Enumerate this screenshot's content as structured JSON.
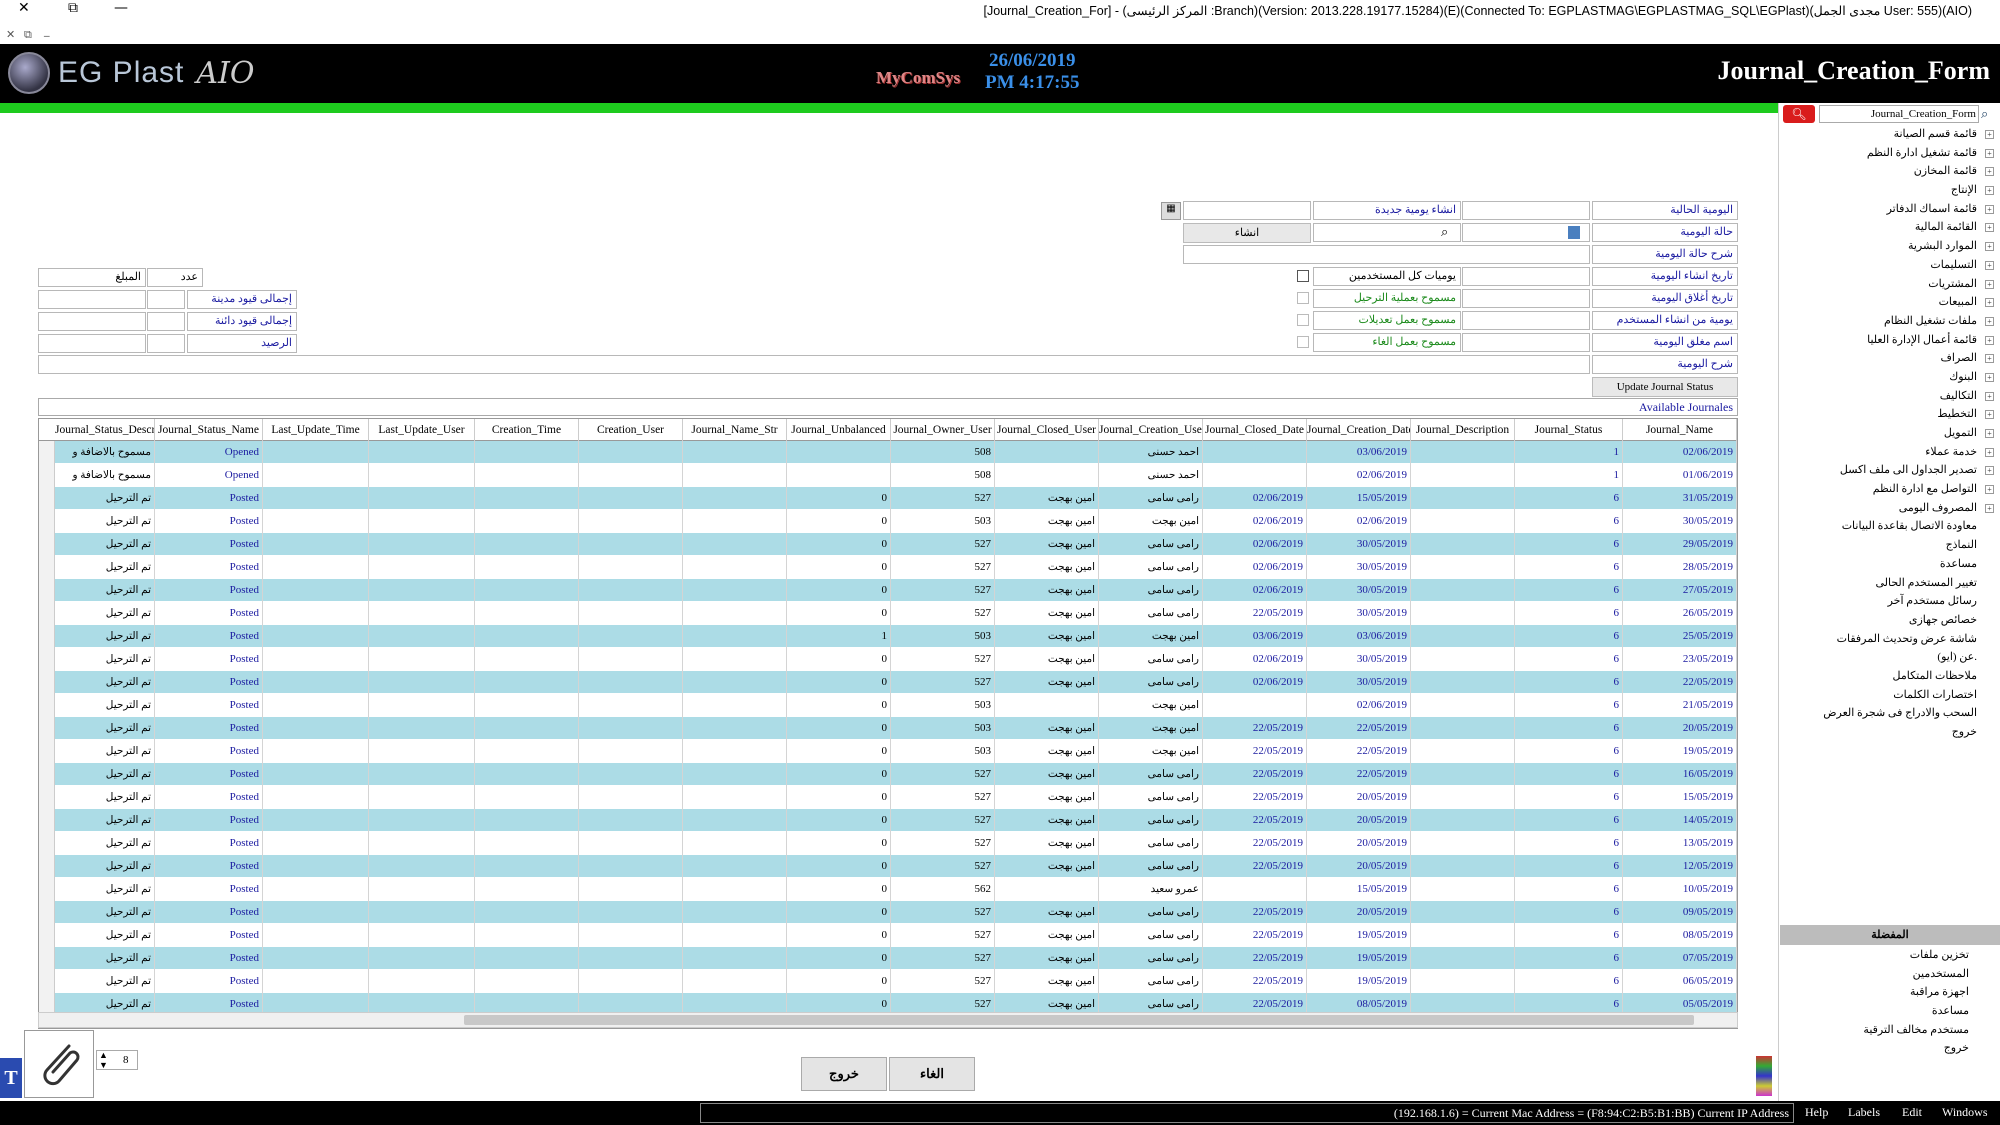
{
  "window": {
    "title": "[Journal_Creation_For] - (المركز الرئيسى :Branch)(Version: 2013.228.19177.15284)(E)(Connected To: EGPLASTMAG\\EGPLASTMAG_SQL\\EGPlast)(مجدى الجمل User: 555)(AIO)",
    "close": "✕",
    "restore": "⧉",
    "minimize": "—",
    "sub_close": "✕",
    "sub_restore": "⧉",
    "sub_min": "_"
  },
  "header": {
    "app_name": "EG Plast",
    "app_suffix": "AIO",
    "vendor": "MyComSys",
    "date": "26/06/2019",
    "time": "PM 4:17:55",
    "form_title": "Journal_Creation_Form"
  },
  "sidebar": {
    "search_value": "Journal_Creation_Form",
    "items": [
      {
        "label": "قائمة قسم الصيانة",
        "exp": "+"
      },
      {
        "label": "قائمة تشغيل ادارة النظم",
        "exp": "+"
      },
      {
        "label": "قائمة المخازن",
        "exp": "+"
      },
      {
        "label": "الإنتاج",
        "exp": "+"
      },
      {
        "label": "قائمة اسماك الدفاتر",
        "exp": "+"
      },
      {
        "label": "القائمة المالية",
        "exp": "+"
      },
      {
        "label": "الموارد البشرية",
        "exp": "+"
      },
      {
        "label": "التسليمات",
        "exp": "+"
      },
      {
        "label": "المشتريات",
        "exp": "+"
      },
      {
        "label": "المبيعات",
        "exp": "+"
      },
      {
        "label": "ملفات تشغيل النظام",
        "exp": "+"
      },
      {
        "label": "قائمة أعمال الإدارة العليا",
        "exp": "+"
      },
      {
        "label": "الصراف",
        "exp": "+"
      },
      {
        "label": "البنوك",
        "exp": "+"
      },
      {
        "label": "التكاليف",
        "exp": "+"
      },
      {
        "label": "التخطيط",
        "exp": "+"
      },
      {
        "label": "التمويل",
        "exp": "+"
      },
      {
        "label": "خدمة عملاء",
        "exp": "+"
      },
      {
        "label": "تصدير الجداول الى ملف اكسل",
        "exp": "+"
      },
      {
        "label": "التواصل مع ادارة النظم",
        "exp": "+"
      },
      {
        "label": "المصروف اليومى",
        "exp": "+"
      },
      {
        "label": "معاودة الاتصال بقاعدة البيانات",
        "exp": ""
      },
      {
        "label": "النماذج",
        "exp": ""
      },
      {
        "label": "مساعدة",
        "exp": ""
      },
      {
        "label": "تغيير المستخدم الحالى",
        "exp": ""
      },
      {
        "label": "رسائل مستخدم آخر",
        "exp": ""
      },
      {
        "label": "خصائص جهازى",
        "exp": ""
      },
      {
        "label": "شاشة عرض وتحديث المرفقات",
        "exp": ""
      },
      {
        "label": "عن (ايو).",
        "exp": ""
      },
      {
        "label": "ملاحظات المتكامل",
        "exp": ""
      },
      {
        "label": "اختصارات الكلمات",
        "exp": ""
      },
      {
        "label": "السحب والادراج فى شجرة العرض",
        "exp": ""
      },
      {
        "label": "خروج",
        "exp": ""
      }
    ],
    "section_title": "المفضلة",
    "bottom_items": [
      "تخزين ملفات",
      "المستخدمين",
      "اجهزة مراقبة",
      "مساعدة",
      "مستخدم مخالف الترقية",
      "خروج"
    ]
  },
  "form": {
    "current_journal_label": "اليومية الحالية",
    "new_journal_label": "انشاء يومية جديدة",
    "journal_status_label": "حالة اليومية",
    "create_button": "انشاء",
    "status_desc_label": "شرح حالة اليومية",
    "creation_date_label": "تاريخ انشاء اليومية",
    "all_users_label": "يوميات كل المستخدمين",
    "closing_date_label": "تاريخ أغلاق اليومية",
    "allow_carry_label": "مسموح بعملية الترحيل",
    "created_by_label": "يومية من انشاء المستخدم",
    "allow_edit_label": "مسموح بعمل تعديلات",
    "closed_by_label": "اسم مغلق اليومية",
    "allow_cancel_label": "مسموح بعمل الغاء",
    "journal_desc_label": "شرح اليومية",
    "update_button": "Update Journal Status",
    "amount_label": "المبلغ",
    "count_label": "عدد",
    "total_debit_label": "إجمالى قيود مدينة",
    "total_credit_label": "إجمالى قيود دائنة",
    "balance_label": "الرصيد",
    "available_label": "Available Journales"
  },
  "grid": {
    "headers": [
      "Journal_Status_Descript",
      "Journal_Status_Name",
      "Last_Update_Time",
      "Last_Update_User",
      "Creation_Time",
      "Creation_User",
      "Journal_Name_Str",
      "Journal_Unbalanced",
      "Journal_Owner_User",
      "Journal_Closed_User",
      "Journal_Creation_User",
      "Journal_Closed_Date",
      "Journal_Creation_Date",
      "Journal_Description",
      "Journal_Status",
      "Journal_Name"
    ],
    "rows": [
      {
        "desc": "مسموح بالاضافة و",
        "sname": "Opened",
        "unb": "",
        "owner": "508",
        "closed_user": "",
        "cr_user": "احمد حسنى",
        "closed_date": "",
        "cr_date": "03/06/2019",
        "status": "1",
        "name": "02/06/2019"
      },
      {
        "desc": "مسموح بالاضافة و",
        "sname": "Opened",
        "unb": "",
        "owner": "508",
        "closed_user": "",
        "cr_user": "احمد حسنى",
        "closed_date": "",
        "cr_date": "02/06/2019",
        "status": "1",
        "name": "01/06/2019"
      },
      {
        "desc": "تم الترحيل",
        "sname": "Posted",
        "unb": "0",
        "owner": "527",
        "closed_user": "امين بهجت",
        "cr_user": "رامى سامى",
        "closed_date": "02/06/2019",
        "cr_date": "15/05/2019",
        "status": "6",
        "name": "31/05/2019"
      },
      {
        "desc": "تم الترحيل",
        "sname": "Posted",
        "unb": "0",
        "owner": "503",
        "closed_user": "امين بهجت",
        "cr_user": "امين بهجت",
        "closed_date": "02/06/2019",
        "cr_date": "02/06/2019",
        "status": "6",
        "name": "30/05/2019"
      },
      {
        "desc": "تم الترحيل",
        "sname": "Posted",
        "unb": "0",
        "owner": "527",
        "closed_user": "امين بهجت",
        "cr_user": "رامى سامى",
        "closed_date": "02/06/2019",
        "cr_date": "30/05/2019",
        "status": "6",
        "name": "29/05/2019"
      },
      {
        "desc": "تم الترحيل",
        "sname": "Posted",
        "unb": "0",
        "owner": "527",
        "closed_user": "امين بهجت",
        "cr_user": "رامى سامى",
        "closed_date": "02/06/2019",
        "cr_date": "30/05/2019",
        "status": "6",
        "name": "28/05/2019"
      },
      {
        "desc": "تم الترحيل",
        "sname": "Posted",
        "unb": "0",
        "owner": "527",
        "closed_user": "امين بهجت",
        "cr_user": "رامى سامى",
        "closed_date": "02/06/2019",
        "cr_date": "30/05/2019",
        "status": "6",
        "name": "27/05/2019"
      },
      {
        "desc": "تم الترحيل",
        "sname": "Posted",
        "unb": "0",
        "owner": "527",
        "closed_user": "امين بهجت",
        "cr_user": "رامى سامى",
        "closed_date": "22/05/2019",
        "cr_date": "30/05/2019",
        "status": "6",
        "name": "26/05/2019"
      },
      {
        "desc": "تم الترحيل",
        "sname": "Posted",
        "unb": "1",
        "owner": "503",
        "closed_user": "امين بهجت",
        "cr_user": "امين بهجت",
        "closed_date": "03/06/2019",
        "cr_date": "03/06/2019",
        "status": "6",
        "name": "25/05/2019"
      },
      {
        "desc": "تم الترحيل",
        "sname": "Posted",
        "unb": "0",
        "owner": "527",
        "closed_user": "امين بهجت",
        "cr_user": "رامى سامى",
        "closed_date": "02/06/2019",
        "cr_date": "30/05/2019",
        "status": "6",
        "name": "23/05/2019"
      },
      {
        "desc": "تم الترحيل",
        "sname": "Posted",
        "unb": "0",
        "owner": "527",
        "closed_user": "امين بهجت",
        "cr_user": "رامى سامى",
        "closed_date": "02/06/2019",
        "cr_date": "30/05/2019",
        "status": "6",
        "name": "22/05/2019"
      },
      {
        "desc": "تم الترحيل",
        "sname": "Posted",
        "unb": "0",
        "owner": "503",
        "closed_user": "",
        "cr_user": "امين بهجت",
        "closed_date": "",
        "cr_date": "02/06/2019",
        "status": "6",
        "name": "21/05/2019"
      },
      {
        "desc": "تم الترحيل",
        "sname": "Posted",
        "unb": "0",
        "owner": "503",
        "closed_user": "امين بهجت",
        "cr_user": "امين بهجت",
        "closed_date": "22/05/2019",
        "cr_date": "22/05/2019",
        "status": "6",
        "name": "20/05/2019"
      },
      {
        "desc": "تم الترحيل",
        "sname": "Posted",
        "unb": "0",
        "owner": "503",
        "closed_user": "امين بهجت",
        "cr_user": "امين بهجت",
        "closed_date": "22/05/2019",
        "cr_date": "22/05/2019",
        "status": "6",
        "name": "19/05/2019"
      },
      {
        "desc": "تم الترحيل",
        "sname": "Posted",
        "unb": "0",
        "owner": "527",
        "closed_user": "امين بهجت",
        "cr_user": "رامى سامى",
        "closed_date": "22/05/2019",
        "cr_date": "22/05/2019",
        "status": "6",
        "name": "16/05/2019"
      },
      {
        "desc": "تم الترحيل",
        "sname": "Posted",
        "unb": "0",
        "owner": "527",
        "closed_user": "امين بهجت",
        "cr_user": "رامى سامى",
        "closed_date": "22/05/2019",
        "cr_date": "20/05/2019",
        "status": "6",
        "name": "15/05/2019"
      },
      {
        "desc": "تم الترحيل",
        "sname": "Posted",
        "unb": "0",
        "owner": "527",
        "closed_user": "امين بهجت",
        "cr_user": "رامى سامى",
        "closed_date": "22/05/2019",
        "cr_date": "20/05/2019",
        "status": "6",
        "name": "14/05/2019"
      },
      {
        "desc": "تم الترحيل",
        "sname": "Posted",
        "unb": "0",
        "owner": "527",
        "closed_user": "امين بهجت",
        "cr_user": "رامى سامى",
        "closed_date": "22/05/2019",
        "cr_date": "20/05/2019",
        "status": "6",
        "name": "13/05/2019"
      },
      {
        "desc": "تم الترحيل",
        "sname": "Posted",
        "unb": "0",
        "owner": "527",
        "closed_user": "امين بهجت",
        "cr_user": "رامى سامى",
        "closed_date": "22/05/2019",
        "cr_date": "20/05/2019",
        "status": "6",
        "name": "12/05/2019"
      },
      {
        "desc": "تم الترحيل",
        "sname": "Posted",
        "unb": "0",
        "owner": "562",
        "closed_user": "",
        "cr_user": "عمرو سعيد",
        "closed_date": "",
        "cr_date": "15/05/2019",
        "status": "6",
        "name": "10/05/2019"
      },
      {
        "desc": "تم الترحيل",
        "sname": "Posted",
        "unb": "0",
        "owner": "527",
        "closed_user": "امين بهجت",
        "cr_user": "رامى سامى",
        "closed_date": "22/05/2019",
        "cr_date": "20/05/2019",
        "status": "6",
        "name": "09/05/2019"
      },
      {
        "desc": "تم الترحيل",
        "sname": "Posted",
        "unb": "0",
        "owner": "527",
        "closed_user": "امين بهجت",
        "cr_user": "رامى سامى",
        "closed_date": "22/05/2019",
        "cr_date": "19/05/2019",
        "status": "6",
        "name": "08/05/2019"
      },
      {
        "desc": "تم الترحيل",
        "sname": "Posted",
        "unb": "0",
        "owner": "527",
        "closed_user": "امين بهجت",
        "cr_user": "رامى سامى",
        "closed_date": "22/05/2019",
        "cr_date": "19/05/2019",
        "status": "6",
        "name": "07/05/2019"
      },
      {
        "desc": "تم الترحيل",
        "sname": "Posted",
        "unb": "0",
        "owner": "527",
        "closed_user": "امين بهجت",
        "cr_user": "رامى سامى",
        "closed_date": "22/05/2019",
        "cr_date": "19/05/2019",
        "status": "6",
        "name": "06/05/2019"
      },
      {
        "desc": "تم الترحيل",
        "sname": "Posted",
        "unb": "0",
        "owner": "527",
        "closed_user": "امين بهجت",
        "cr_user": "رامى سامى",
        "closed_date": "22/05/2019",
        "cr_date": "08/05/2019",
        "status": "6",
        "name": "05/05/2019"
      }
    ]
  },
  "footer": {
    "spin_value": "8",
    "exit_button": "خروج",
    "cancel_button": "الغاء",
    "ip_status": "(192.168.1.6) = Current Mac Address = (F8:94:C2:B5:B1:BB) Current IP Address",
    "menu": [
      "Help",
      "Labels",
      "Edit",
      "Windows"
    ]
  },
  "colors": {
    "header_bg": "#000000",
    "accent_green": "#1ecb1e",
    "row_alt": "#acdce6",
    "clock": "#3a8fe8",
    "search_red": "#d91c1c"
  }
}
